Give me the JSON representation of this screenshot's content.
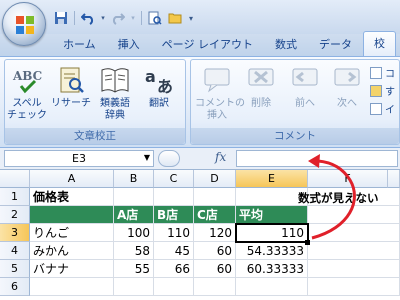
{
  "tabs": [
    "ホーム",
    "挿入",
    "ページ レイアウト",
    "数式",
    "データ",
    "校"
  ],
  "ribbon": {
    "groups": [
      {
        "label": "文章校正",
        "buttons": [
          {
            "label": "スペル\nチェック",
            "icon": "abc-icon"
          },
          {
            "label": "リサーチ",
            "icon": "research-icon"
          },
          {
            "label": "類義語\n辞典",
            "icon": "thesaurus-icon"
          },
          {
            "label": "翻訳",
            "icon": "translate-icon"
          }
        ]
      },
      {
        "label": "コメント",
        "buttons": [
          {
            "label": "コメントの\n挿入",
            "icon": "new-comment-icon"
          },
          {
            "label": "削除",
            "icon": "delete-icon"
          },
          {
            "label": "前へ",
            "icon": "previous-icon"
          },
          {
            "label": "次へ",
            "icon": "next-icon"
          }
        ]
      }
    ],
    "small_buttons": [
      "コ",
      "す",
      "イ"
    ]
  },
  "formula_bar": {
    "name_box": "E3",
    "fx": "fx",
    "formula": ""
  },
  "columns": [
    "A",
    "B",
    "C",
    "D",
    "E",
    "F"
  ],
  "rows": [
    "1",
    "2",
    "3",
    "4",
    "5",
    "6"
  ],
  "sheet": {
    "title": "価格表",
    "headers": [
      "A店",
      "B店",
      "C店",
      "平均"
    ],
    "data": [
      {
        "name": "りんご",
        "a": "100",
        "b": "110",
        "c": "120",
        "avg": "110"
      },
      {
        "name": "みかん",
        "a": "58",
        "b": "45",
        "c": "60",
        "avg": "54.33333"
      },
      {
        "name": "バナナ",
        "a": "55",
        "b": "66",
        "c": "60",
        "avg": "60.33333"
      }
    ]
  },
  "annotation": "数式が見えない",
  "colors": {
    "header_green": "#2e8b57",
    "arrow": "#e0202a"
  }
}
